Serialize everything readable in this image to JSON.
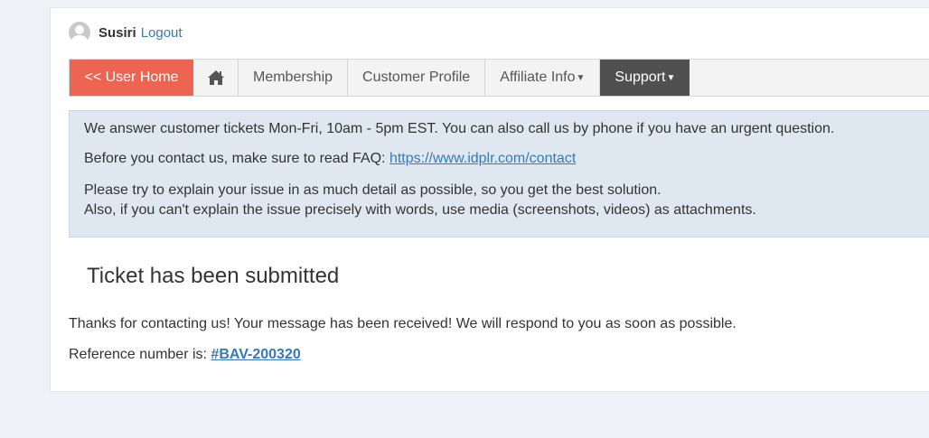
{
  "user": {
    "name": "Susiri",
    "logout_label": "Logout"
  },
  "nav": {
    "user_home": "<< User Home",
    "membership": "Membership",
    "customer_profile": "Customer Profile",
    "affiliate_info": "Affiliate Info",
    "support": "Support",
    "home_icon": "home-icon",
    "caret_icon": "caret-down-icon"
  },
  "info": {
    "line1": "We answer customer tickets Mon-Fri, 10am - 5pm EST. You can also call us by phone if you have an urgent question.",
    "line2_prefix": "Before you contact us, make sure to read FAQ:",
    "faq_link": "https://www.idplr.com/contact",
    "line3": "Please try to explain your issue in as much detail as possible, so you get the best solution.",
    "line4": "Also, if you can't explain the issue precisely with words, use media (screenshots, videos) as attachments."
  },
  "result": {
    "title": "Ticket has been submitted",
    "message": "Thanks for contacting us! Your message has been received! We will respond to you as soon as possible.",
    "reference_label": "Reference number is:",
    "reference_number": "#BAV-200320"
  },
  "colors": {
    "accent": "#ee6452",
    "active_tab": "#505050",
    "link": "#337ab7",
    "info_bg": "#dfe8f1",
    "page_bg": "#eef2f7"
  }
}
